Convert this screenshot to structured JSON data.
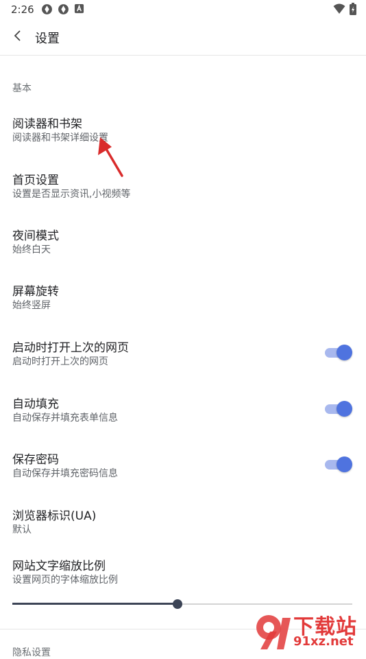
{
  "status": {
    "time": "2:26"
  },
  "appbar": {
    "title": "设置"
  },
  "section": {
    "header": "基本"
  },
  "rows": [
    {
      "title": "阅读器和书架",
      "subtitle": "阅读器和书架详细设置"
    },
    {
      "title": "首页设置",
      "subtitle": "设置是否显示资讯,小视频等"
    },
    {
      "title": "夜间模式",
      "subtitle": "始终白天"
    },
    {
      "title": "屏幕旋转",
      "subtitle": "始终竖屏"
    },
    {
      "title": "启动时打开上次的网页",
      "subtitle": "启动时打开上次的网页",
      "toggle_on": true
    },
    {
      "title": "自动填充",
      "subtitle": "自动保存并填充表单信息",
      "toggle_on": true
    },
    {
      "title": "保存密码",
      "subtitle": "自动保存并填充密码信息",
      "toggle_on": true
    },
    {
      "title": "浏览器标识(UA)",
      "subtitle": "默认"
    },
    {
      "title": "网站文字缩放比例",
      "subtitle": "设置网页的字体缩放比例"
    }
  ],
  "text_scale_slider": {
    "fraction": 0.485
  },
  "next_section_partial": "隐私设置",
  "watermark": {
    "line1": "下载站",
    "line2": "91xz.net"
  },
  "colors": {
    "accent": "#4f73df",
    "accent_track": "#a8b8ee",
    "annotation_arrow": "#d92b2b",
    "watermark": "#e23a3a"
  },
  "icons": {
    "status_left": [
      "aperture-icon",
      "aperture-icon",
      "font-a-icon"
    ],
    "status_right": [
      "wifi-icon",
      "battery-icon"
    ],
    "back": "chevron-left-icon"
  }
}
